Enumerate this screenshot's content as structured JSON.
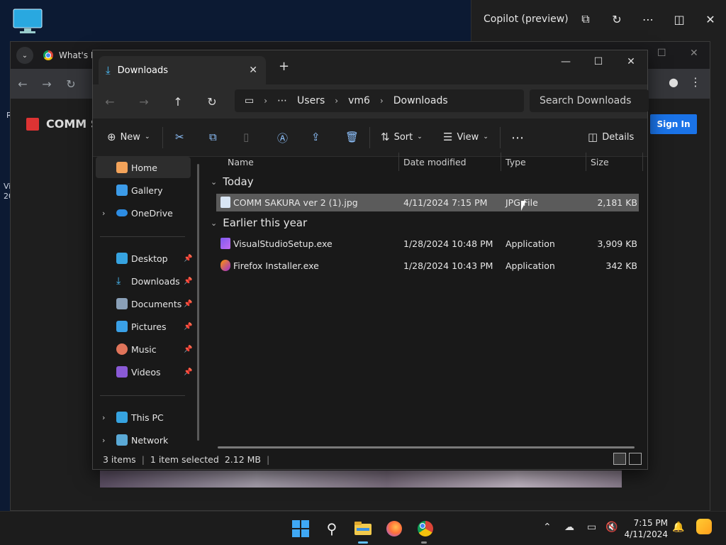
{
  "desktop": {
    "edge_labels": [
      "R",
      "Vi",
      "20"
    ]
  },
  "copilot": {
    "title": "Copilot (preview)"
  },
  "browser": {
    "tab_title": "What's I",
    "brand": "COMM S",
    "signin_label": "Sign In"
  },
  "explorer": {
    "tab_title": "Downloads",
    "breadcrumb": [
      "Users",
      "vm6",
      "Downloads"
    ],
    "search_placeholder": "Search Downloads",
    "commands": {
      "new": "New",
      "sort": "Sort",
      "view": "View",
      "details": "Details"
    },
    "nav": {
      "home": "Home",
      "gallery": "Gallery",
      "onedrive": "OneDrive",
      "desktop": "Desktop",
      "downloads": "Downloads",
      "documents": "Documents",
      "pictures": "Pictures",
      "music": "Music",
      "videos": "Videos",
      "thispc": "This PC",
      "network": "Network"
    },
    "columns": {
      "name": "Name",
      "date": "Date modified",
      "type": "Type",
      "size": "Size"
    },
    "groups": {
      "today": "Today",
      "earlier": "Earlier this year"
    },
    "files": [
      {
        "name": "COMM SAKURA ver 2 (1).jpg",
        "date": "4/11/2024 7:15 PM",
        "type": "JPG File",
        "size": "2,181 KB",
        "selected": true
      },
      {
        "name": "VisualStudioSetup.exe",
        "date": "1/28/2024 10:48 PM",
        "type": "Application",
        "size": "3,909 KB",
        "selected": false
      },
      {
        "name": "Firefox Installer.exe",
        "date": "1/28/2024 10:43 PM",
        "type": "Application",
        "size": "342 KB",
        "selected": false
      }
    ],
    "status": {
      "items": "3 items",
      "selection": "1 item selected",
      "size": "2.12 MB"
    }
  },
  "taskbar": {
    "time": "7:15 PM",
    "date": "4/11/2024"
  }
}
